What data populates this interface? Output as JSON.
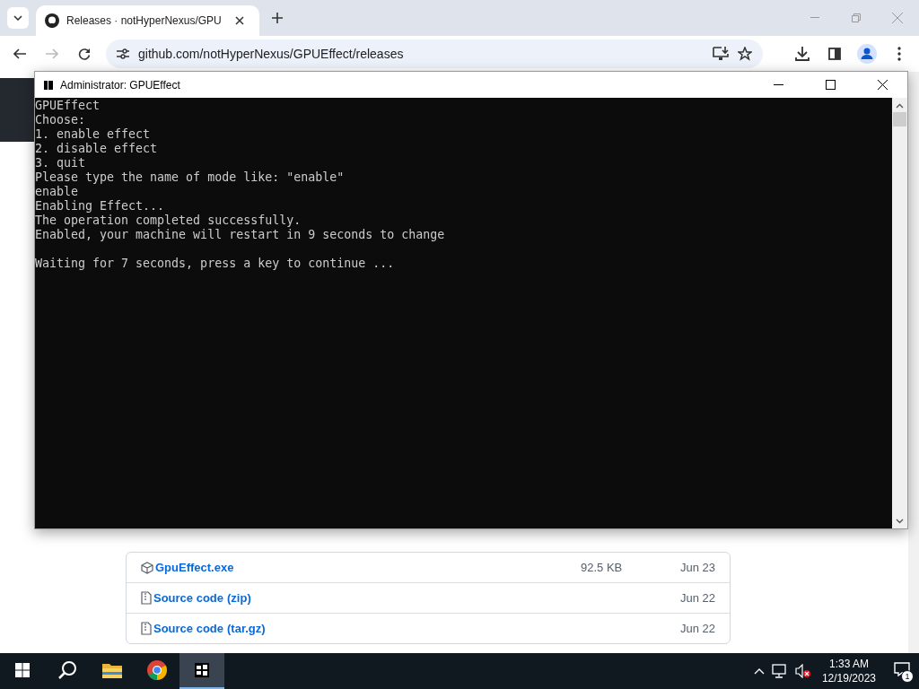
{
  "browser": {
    "tab": {
      "title": "Releases · notHyperNexus/GPU",
      "selected": true
    },
    "address": "github.com/notHyperNexus/GPUEffect/releases"
  },
  "assets": [
    {
      "kind": "exe",
      "name": "GpuEffect.exe",
      "size": "92.5 KB",
      "date": "Jun 23"
    },
    {
      "kind": "source",
      "name": "Source code",
      "suffix": "(zip)",
      "date": "Jun 22"
    },
    {
      "kind": "source",
      "name": "Source code",
      "suffix": "(tar.gz)",
      "date": "Jun 22"
    }
  ],
  "console": {
    "title": "Administrator:  GPUEffect",
    "lines": [
      "GPUEffect",
      "Choose:",
      "1. enable effect",
      "2. disable effect",
      "3. quit",
      "Please type the name of mode like: \"enable\"",
      "enable",
      "Enabling Effect...",
      "The operation completed successfully.",
      "Enabled, your machine will restart in 9 seconds to change"
    ],
    "status_line": "Waiting for 7 seconds, press a key to continue ..."
  },
  "taskbar": {
    "apps": [
      {
        "kind": "search",
        "active": false
      },
      {
        "kind": "explorer",
        "active": false
      },
      {
        "kind": "chrome",
        "active": false
      },
      {
        "kind": "console",
        "active": true
      }
    ],
    "time": "1:33 AM",
    "date": "12/19/2023",
    "notifications": "1"
  }
}
